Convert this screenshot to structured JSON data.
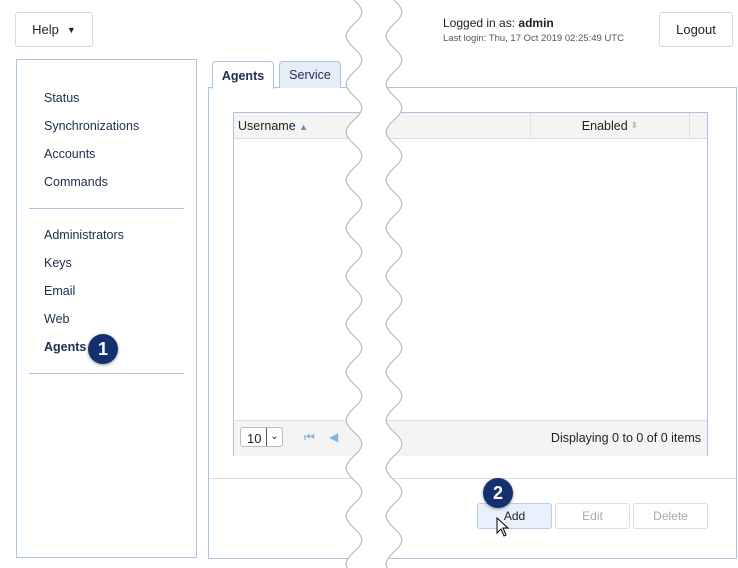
{
  "header": {
    "help_label": "Help",
    "logged_in_prefix": "Logged in as: ",
    "username": "admin",
    "last_login": "Last login: Thu, 17 Oct 2019 02:25:49 UTC",
    "logout_label": "Logout"
  },
  "sidebar": {
    "group1": [
      "Status",
      "Synchronizations",
      "Accounts",
      "Commands"
    ],
    "group2": [
      "Administrators",
      "Keys",
      "Email",
      "Web",
      "Agents"
    ],
    "active": "Agents"
  },
  "tabs": [
    "Agents",
    "Service"
  ],
  "grid": {
    "columns": [
      "Username",
      "Enabled"
    ],
    "page_size": "10",
    "status": "Displaying 0 to 0 of 0 items"
  },
  "actions": {
    "add": "Add",
    "edit": "Edit",
    "delete": "Delete"
  },
  "callouts": [
    "1",
    "2"
  ],
  "colors": {
    "accent_border": "#a9c3e0",
    "badge": "#15306e",
    "text": "#1c2d4f"
  }
}
